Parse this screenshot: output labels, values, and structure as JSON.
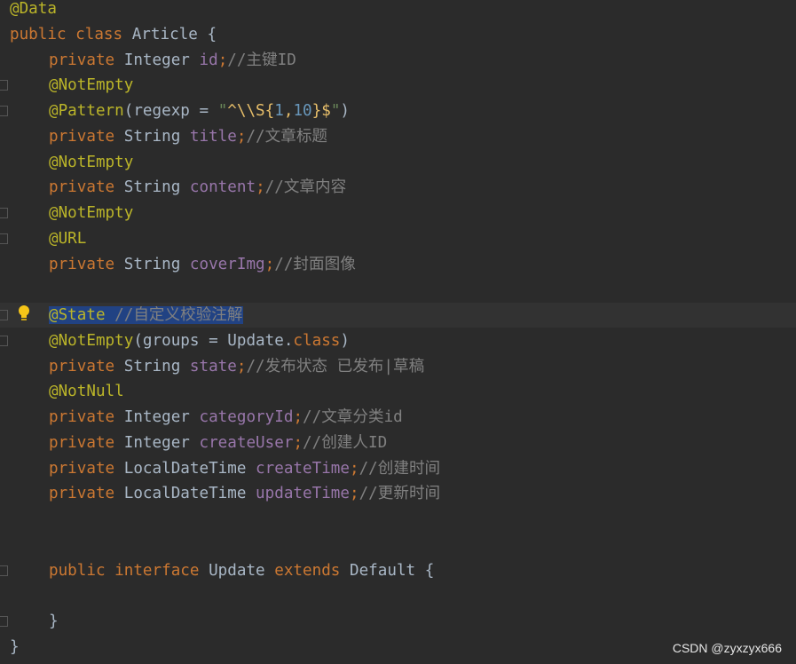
{
  "editor": {
    "lines": [
      {
        "tokens": [
          {
            "t": "@Data",
            "c": "ann"
          }
        ]
      },
      {
        "tokens": [
          {
            "t": "public ",
            "c": "kw"
          },
          {
            "t": "class ",
            "c": "kw"
          },
          {
            "t": "Article {",
            "c": "pl"
          }
        ]
      },
      {
        "tokens": [
          {
            "t": "private ",
            "c": "kw"
          },
          {
            "t": "Integer ",
            "c": "pl"
          },
          {
            "t": "id",
            "c": "fld"
          },
          {
            "t": ";",
            "c": "kw"
          },
          {
            "t": "//主键ID",
            "c": "cmt"
          }
        ]
      },
      {
        "tokens": [
          {
            "t": "@NotEmpty",
            "c": "ann"
          }
        ]
      },
      {
        "tokens": [
          {
            "t": "@Pattern",
            "c": "ann"
          },
          {
            "t": "(regexp = ",
            "c": "pl"
          },
          {
            "t": "\"",
            "c": "str"
          },
          {
            "t": "^\\\\S{",
            "c": "rx"
          },
          {
            "t": "1",
            "c": "rxn"
          },
          {
            "t": ",",
            "c": "rx"
          },
          {
            "t": "10",
            "c": "rxn"
          },
          {
            "t": "}$",
            "c": "rx"
          },
          {
            "t": "\"",
            "c": "str"
          },
          {
            "t": ")",
            "c": "pl"
          }
        ]
      },
      {
        "tokens": [
          {
            "t": "private ",
            "c": "kw"
          },
          {
            "t": "String ",
            "c": "pl"
          },
          {
            "t": "title",
            "c": "fld"
          },
          {
            "t": ";",
            "c": "kw"
          },
          {
            "t": "//文章标题",
            "c": "cmt"
          }
        ]
      },
      {
        "tokens": [
          {
            "t": "@NotEmpty",
            "c": "ann"
          }
        ]
      },
      {
        "tokens": [
          {
            "t": "private ",
            "c": "kw"
          },
          {
            "t": "String ",
            "c": "pl"
          },
          {
            "t": "content",
            "c": "fld"
          },
          {
            "t": ";",
            "c": "kw"
          },
          {
            "t": "//文章内容",
            "c": "cmt"
          }
        ]
      },
      {
        "tokens": [
          {
            "t": "@NotEmpty",
            "c": "ann"
          }
        ]
      },
      {
        "tokens": [
          {
            "t": "@URL",
            "c": "ann"
          }
        ]
      },
      {
        "tokens": [
          {
            "t": "private ",
            "c": "kw"
          },
          {
            "t": "String ",
            "c": "pl"
          },
          {
            "t": "coverImg",
            "c": "fld"
          },
          {
            "t": ";",
            "c": "kw"
          },
          {
            "t": "//封面图像",
            "c": "cmt"
          }
        ]
      },
      {
        "tokens": []
      },
      {
        "tokens": [
          {
            "t": "@State ",
            "c": "ann"
          },
          {
            "t": "//自定义校验注解",
            "c": "cmt"
          }
        ]
      },
      {
        "tokens": [
          {
            "t": "@NotEmpty",
            "c": "ann"
          },
          {
            "t": "(groups = Update.",
            "c": "pl"
          },
          {
            "t": "class",
            "c": "kw"
          },
          {
            "t": ")",
            "c": "pl"
          }
        ]
      },
      {
        "tokens": [
          {
            "t": "private ",
            "c": "kw"
          },
          {
            "t": "String ",
            "c": "pl"
          },
          {
            "t": "state",
            "c": "fld"
          },
          {
            "t": ";",
            "c": "kw"
          },
          {
            "t": "//发布状态 已发布|草稿",
            "c": "cmt"
          }
        ]
      },
      {
        "tokens": [
          {
            "t": "@NotNull",
            "c": "ann"
          }
        ]
      },
      {
        "tokens": [
          {
            "t": "private ",
            "c": "kw"
          },
          {
            "t": "Integer ",
            "c": "pl"
          },
          {
            "t": "categoryId",
            "c": "fld"
          },
          {
            "t": ";",
            "c": "kw"
          },
          {
            "t": "//文章分类id",
            "c": "cmt"
          }
        ]
      },
      {
        "tokens": [
          {
            "t": "private ",
            "c": "kw"
          },
          {
            "t": "Integer ",
            "c": "pl"
          },
          {
            "t": "createUser",
            "c": "fld"
          },
          {
            "t": ";",
            "c": "kw"
          },
          {
            "t": "//创建人ID",
            "c": "cmt"
          }
        ]
      },
      {
        "tokens": [
          {
            "t": "private ",
            "c": "kw"
          },
          {
            "t": "LocalDateTime ",
            "c": "pl"
          },
          {
            "t": "createTime",
            "c": "fld"
          },
          {
            "t": ";",
            "c": "kw"
          },
          {
            "t": "//创建时间",
            "c": "cmt"
          }
        ]
      },
      {
        "tokens": [
          {
            "t": "private ",
            "c": "kw"
          },
          {
            "t": "LocalDateTime ",
            "c": "pl"
          },
          {
            "t": "updateTime",
            "c": "fld"
          },
          {
            "t": ";",
            "c": "kw"
          },
          {
            "t": "//更新时间",
            "c": "cmt"
          }
        ]
      },
      {
        "tokens": []
      },
      {
        "tokens": []
      },
      {
        "tokens": [
          {
            "t": "public ",
            "c": "kw"
          },
          {
            "t": "interface ",
            "c": "kw"
          },
          {
            "t": "Update ",
            "c": "pl"
          },
          {
            "t": "extends ",
            "c": "kw"
          },
          {
            "t": "Default {",
            "c": "pl"
          }
        ]
      },
      {
        "tokens": []
      },
      {
        "tokens": [
          {
            "t": "}",
            "c": "pl"
          }
        ]
      },
      {
        "tokens": [
          {
            "t": "}",
            "c": "pl"
          }
        ]
      }
    ]
  },
  "watermark": "CSDN @zyxzyx666",
  "colors": {
    "background": "#2b2b2b",
    "keyword": "#cc7832",
    "annotation": "#bbb529",
    "field": "#9876aa",
    "comment": "#808080",
    "plain": "#a9b7c6",
    "selection": "#214283"
  },
  "icons": [
    "intention-bulb-icon",
    "fold-marker-icon"
  ]
}
